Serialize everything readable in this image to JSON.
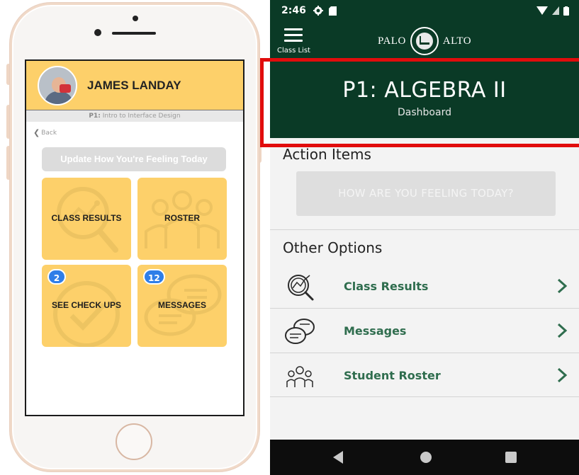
{
  "left_phone": {
    "profile_name": "JAMES LANDAY",
    "course_code": "P1:",
    "course_title": "Intro to Interface Design",
    "back_label": "Back",
    "update_button": "Update How You're Feeling Today",
    "tiles": [
      {
        "label": "CLASS RESULTS",
        "badge": null,
        "icon": "magnifier-chart-icon"
      },
      {
        "label": "ROSTER",
        "badge": null,
        "icon": "people-group-icon"
      },
      {
        "label": "SEE CHECK UPS",
        "badge": "2",
        "icon": "check-circle-icon"
      },
      {
        "label": "MESSAGES",
        "badge": "12",
        "icon": "chat-bubbles-icon"
      }
    ],
    "colors": {
      "accent": "#fdd06a",
      "badge": "#2f7ee8",
      "button_disabled": "#dcdcdc"
    }
  },
  "right_phone": {
    "status": {
      "time": "2:46",
      "left_icons": [
        "gear-icon",
        "sd-card-icon"
      ],
      "right_icons": [
        "wifi-icon",
        "signal-icon",
        "battery-icon"
      ]
    },
    "appbar": {
      "menu_label": "Class List",
      "brand_left": "PALO",
      "brand_right": "ALTO",
      "logo": "palo-alto-seal"
    },
    "hero": {
      "title": "P1: ALGEBRA II",
      "subtitle": "Dashboard"
    },
    "action_items": {
      "heading": "Action Items",
      "feeling_button": "HOW ARE YOU FEELING TODAY?"
    },
    "other_options": {
      "heading": "Other Options",
      "items": [
        {
          "label": "Class Results",
          "icon": "magnifier-chart-icon"
        },
        {
          "label": "Messages",
          "icon": "chat-bubbles-icon"
        },
        {
          "label": "Student Roster",
          "icon": "people-group-icon"
        }
      ]
    },
    "colors": {
      "primary": "#0a3a26",
      "link": "#2f6d4e",
      "highlight_box": "#e10c0c"
    }
  }
}
